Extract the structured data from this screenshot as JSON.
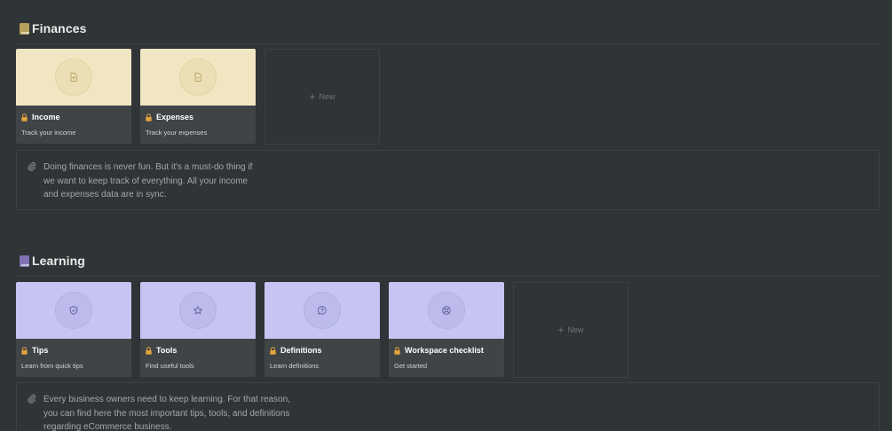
{
  "finances": {
    "title": "Finances",
    "icon_color": "#b5a15c",
    "cards": [
      {
        "title": "Income",
        "subtitle": "Track your income",
        "icon": "file-plus-icon"
      },
      {
        "title": "Expenses",
        "subtitle": "Track your expenses",
        "icon": "file-minus-icon"
      }
    ],
    "cover_color": "#f0e6c1",
    "new_label": "New",
    "callout": "Doing finances is never fun. But it's a must-do thing if we want to keep track of everything. All your income and expenses data are in sync."
  },
  "learning": {
    "title": "Learning",
    "icon_color": "#7f73b4",
    "cards": [
      {
        "title": "Tips",
        "subtitle": "Learn from quick tips",
        "icon": "shield-icon"
      },
      {
        "title": "Tools",
        "subtitle": "Find useful tools",
        "icon": "star-icon"
      },
      {
        "title": "Definitions",
        "subtitle": "Learn definitions",
        "icon": "question-chat-icon"
      },
      {
        "title": "Workspace checklist",
        "subtitle": "Get started",
        "icon": "lifebuoy-icon"
      }
    ],
    "cover_color": "#c5c4f3",
    "new_label": "New",
    "callout": "Every business owners need to keep learning. For that reason, you can find here the most important tips, tools, and definitions regarding eCommerce business."
  },
  "colors": {
    "background": "#2f3437",
    "card_body": "#3f4447",
    "lock": "#e4a23a"
  }
}
